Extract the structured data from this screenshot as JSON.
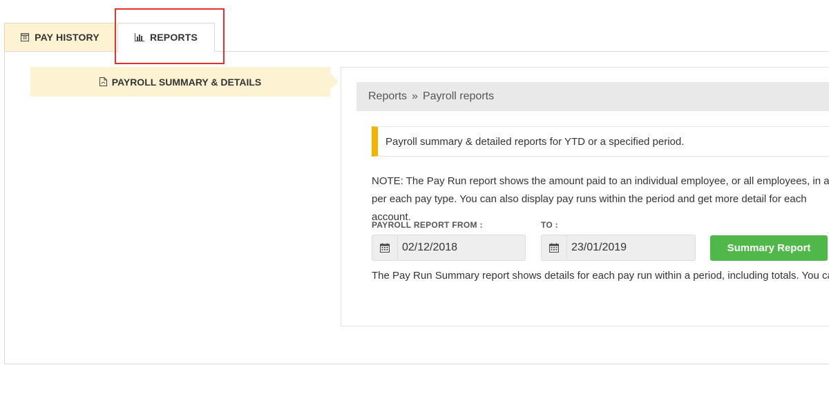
{
  "tabs": {
    "pay_history": "PAY HISTORY",
    "reports": "REPORTS"
  },
  "sidebar": {
    "items": [
      {
        "label": "PAYROLL SUMMARY & DETAILS",
        "icon": "pdf-file-icon"
      }
    ]
  },
  "breadcrumb": {
    "root": "Reports",
    "separator": "»",
    "current": "Payroll reports"
  },
  "info": {
    "text": "Payroll summary & detailed reports for YTD or a specified period."
  },
  "note": {
    "text": "NOTE: The Pay Run report shows the amount paid to an individual employee, or all employees, in a per each pay type. You can also display pay runs within the period and get more detail for each account."
  },
  "form": {
    "from_label": "PAYROLL REPORT FROM :",
    "from_value": "02/12/2018",
    "to_label": "TO :",
    "to_value": "23/01/2019",
    "button_label": "Summary Report"
  },
  "description": {
    "text": "The Pay Run Summary report shows details for each pay run within a period, including totals. You can a"
  },
  "colors": {
    "accent_yellow": "#f5b300",
    "tab_inactive_bg": "#fdf3d2",
    "button_green": "#4fb848",
    "highlight_red": "#e8302a"
  }
}
